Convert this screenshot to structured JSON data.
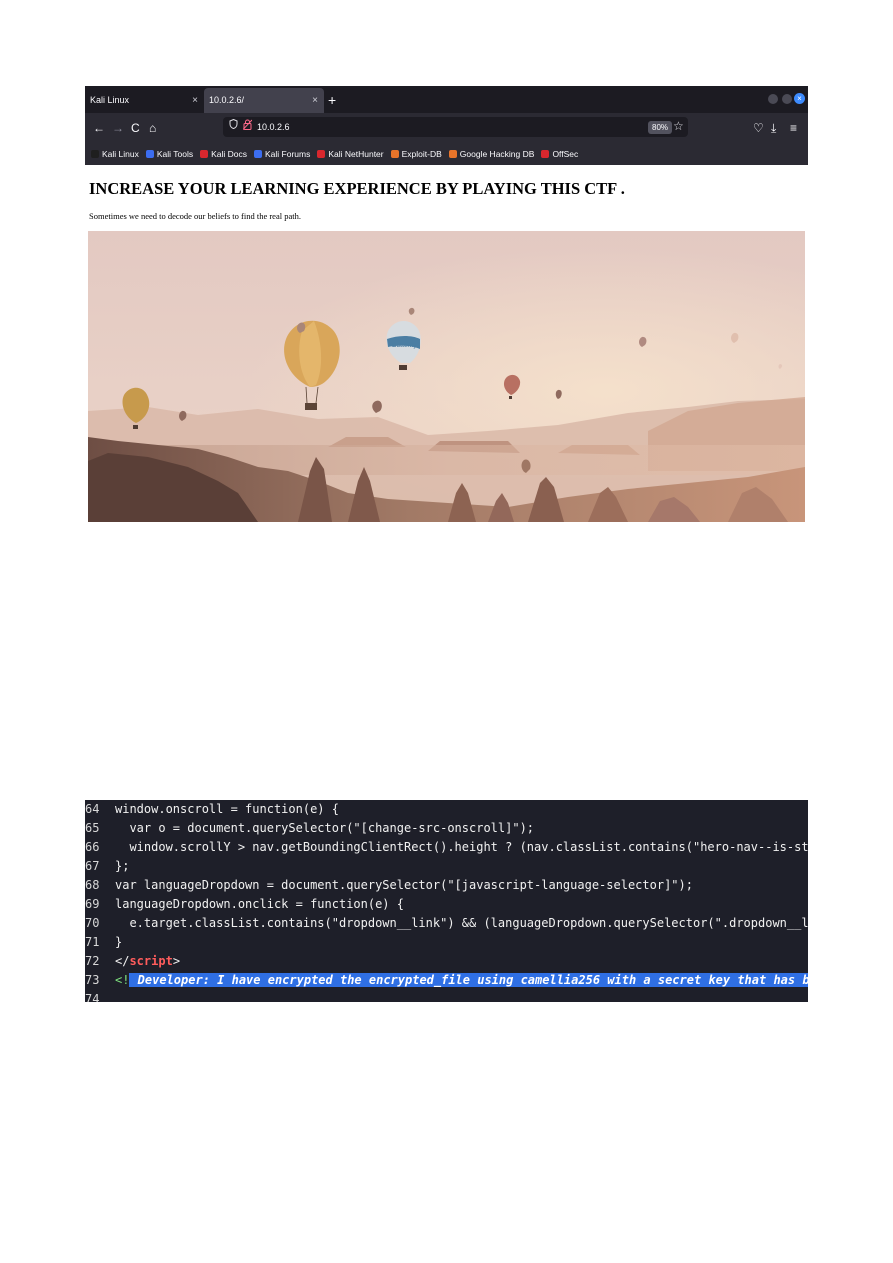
{
  "browser": {
    "tabs": [
      {
        "label": "Kali Linux",
        "close": "×"
      },
      {
        "label": "10.0.2.6/",
        "close": "×"
      }
    ],
    "new_tab": "+",
    "window_close": "×",
    "nav": {
      "back": "←",
      "forward": "→",
      "reload": "C",
      "home": "⌂"
    },
    "url": "10.0.2.6",
    "zoom": "80%",
    "toolbar": {
      "pocket": "♡",
      "download": "⤓",
      "menu": "≡"
    },
    "bookmarks": [
      {
        "label": "Kali Linux",
        "icon_color": "#1f1f1f"
      },
      {
        "label": "Kali Tools",
        "icon_color": "#3c6df0"
      },
      {
        "label": "Kali Docs",
        "icon_color": "#d9272e"
      },
      {
        "label": "Kali Forums",
        "icon_color": "#3c6df0"
      },
      {
        "label": "Kali NetHunter",
        "icon_color": "#d9272e"
      },
      {
        "label": "Exploit-DB",
        "icon_color": "#e8742a"
      },
      {
        "label": "Google Hacking DB",
        "icon_color": "#e8742a"
      },
      {
        "label": "OffSec",
        "icon_color": "#d9272e"
      }
    ]
  },
  "page": {
    "heading": "INCREASE YOUR LEARNING EXPERIENCE BY PLAYING THIS CTF .",
    "tagline": "Sometimes we need to decode our beliefs to find the real path.",
    "hero_balloon_text": "Butterfly"
  },
  "code": {
    "lines": [
      {
        "num": "64",
        "text": "window.onscroll = function(e) {"
      },
      {
        "num": "65",
        "text": "  var o = document.querySelector(\"[change-src-onscroll]\");"
      },
      {
        "num": "66",
        "text": "  window.scrollY > nav.getBoundingClientRect().height ? (nav.classList.contains(\"hero-nav--is-sticky\") || (window"
      },
      {
        "num": "67",
        "text": "};"
      },
      {
        "num": "68",
        "text": "var languageDropdown = document.querySelector(\"[javascript-language-selector]\");"
      },
      {
        "num": "69",
        "text": "languageDropdown.onclick = function(e) {"
      },
      {
        "num": "70",
        "text": "  e.target.classList.contains(\"dropdown__link\") && (languageDropdown.querySelector(\".dropdown__link--selected\").c"
      },
      {
        "num": "71",
        "text": "}"
      }
    ],
    "script_close": {
      "num": "72",
      "open": "</",
      "tag": "script",
      "close": ">"
    },
    "comment": {
      "num": "73",
      "open": "<!",
      "text": " Developer: I have encrypted the encrypted_file using camellia256 with a secret key that has been hashed. ",
      "close": ">"
    },
    "last_line_num": "74"
  }
}
